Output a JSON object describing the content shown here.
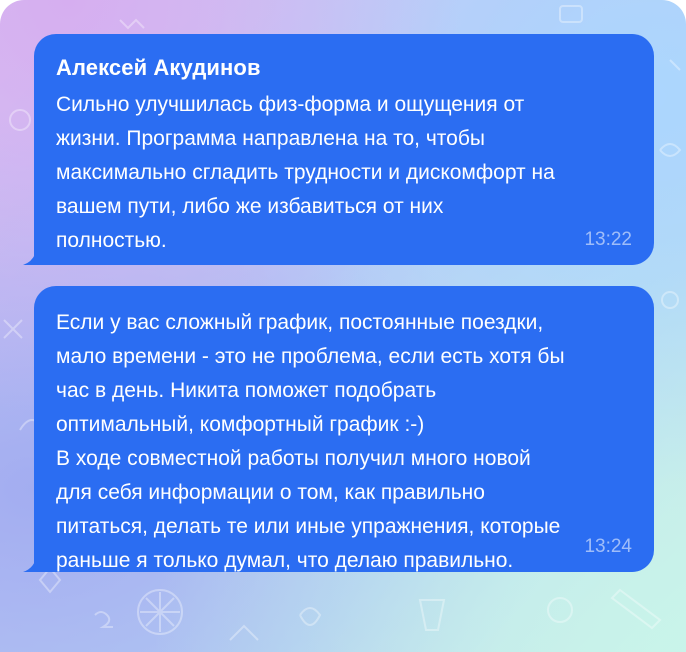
{
  "messages": [
    {
      "sender": "Алексей Акудинов",
      "text": "Сильно улучшилась физ-форма и ощущения от\nжизни. Программа направлена на то, чтобы\nмаксимально сгладить трудности и дискомфорт на\nвашем пути, либо же избавиться от них\nполностью.",
      "time": "13:22"
    },
    {
      "text": "Если у вас сложный график, постоянные поездки,\nмало времени - это не проблема, если есть хотя бы\nчас в день. Никита поможет подобрать\nоптимальный, комфортный график :-)\nВ ходе совместной работы получил много новой\nдля себя информации о том, как правильно\nпитаться, делать те или иные упражнения, которые\nраньше я только думал, что делаю правильно.",
      "time": "13:24"
    }
  ],
  "colors": {
    "bubble": "#2b6df2",
    "text": "#ffffff",
    "time": "rgba(255,255,255,0.55)"
  }
}
